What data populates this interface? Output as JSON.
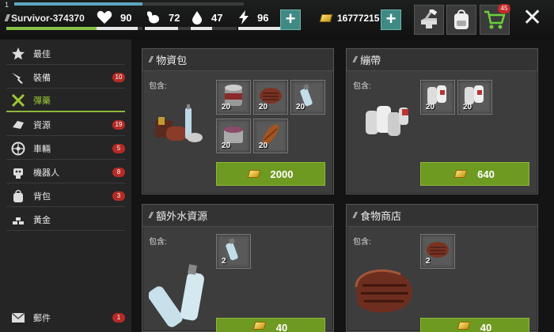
{
  "player": {
    "level": "1",
    "name": "Survivor-374370",
    "xp_fraction": 0.56,
    "hp_fraction": 0.78
  },
  "stats": {
    "health": {
      "value": "90",
      "icon": "heart-icon",
      "fraction": 0.9
    },
    "food": {
      "value": "72",
      "icon": "stomach-icon",
      "fraction": 0.72
    },
    "water": {
      "value": "47",
      "icon": "water-drop-icon",
      "fraction": 0.47
    },
    "energy": {
      "value": "96",
      "icon": "lightning-icon",
      "fraction": 0.96
    }
  },
  "gold": {
    "value": "16777215",
    "icon": "gold-bar-icon"
  },
  "toolbar": {
    "craft_icon": "anvil-hammer-icon",
    "backpack_icon": "backpack-icon",
    "cart_icon": "shopping-cart-icon",
    "cart_badge": "45",
    "close_icon": "close-icon"
  },
  "sidebar": {
    "items": [
      {
        "label": "最佳",
        "icon": "star-icon",
        "badge": ""
      },
      {
        "label": "裝備",
        "icon": "equipment-icon",
        "badge": "10"
      },
      {
        "label": "彈藥",
        "icon": "ammo-icon",
        "badge": "",
        "active": true
      },
      {
        "label": "資源",
        "icon": "resources-icon",
        "badge": "19"
      },
      {
        "label": "車輛",
        "icon": "wheel-icon",
        "badge": "5"
      },
      {
        "label": "機器人",
        "icon": "robot-icon",
        "badge": "8"
      },
      {
        "label": "背包",
        "icon": "backpack-icon",
        "badge": "3"
      },
      {
        "label": "黃金",
        "icon": "gold-stack-icon",
        "badge": ""
      },
      {
        "label": "郵件",
        "icon": "mail-icon",
        "badge": "1"
      }
    ]
  },
  "cards": [
    {
      "title": "物資包",
      "contains_label": "包含:",
      "items": [
        {
          "icon": "canned-food-icon",
          "qty": "20"
        },
        {
          "icon": "steak-icon",
          "qty": "20"
        },
        {
          "icon": "water-bottle-icon",
          "qty": "20"
        },
        {
          "icon": "soup-can-icon",
          "qty": "20"
        },
        {
          "icon": "corn-icon",
          "qty": "20"
        }
      ],
      "price": "2000"
    },
    {
      "title": "繃帶",
      "contains_label": "包含:",
      "items": [
        {
          "icon": "bandage-icon",
          "qty": "20"
        },
        {
          "icon": "bandage-icon",
          "qty": "20"
        }
      ],
      "price": "640"
    },
    {
      "title": "額外水資源",
      "contains_label": "包含:",
      "items": [
        {
          "icon": "water-bottle-icon",
          "qty": "2"
        }
      ],
      "price": "40"
    },
    {
      "title": "食物商店",
      "contains_label": "包含:",
      "items": [
        {
          "icon": "steak-icon",
          "qty": "2"
        }
      ],
      "price": "40"
    }
  ]
}
